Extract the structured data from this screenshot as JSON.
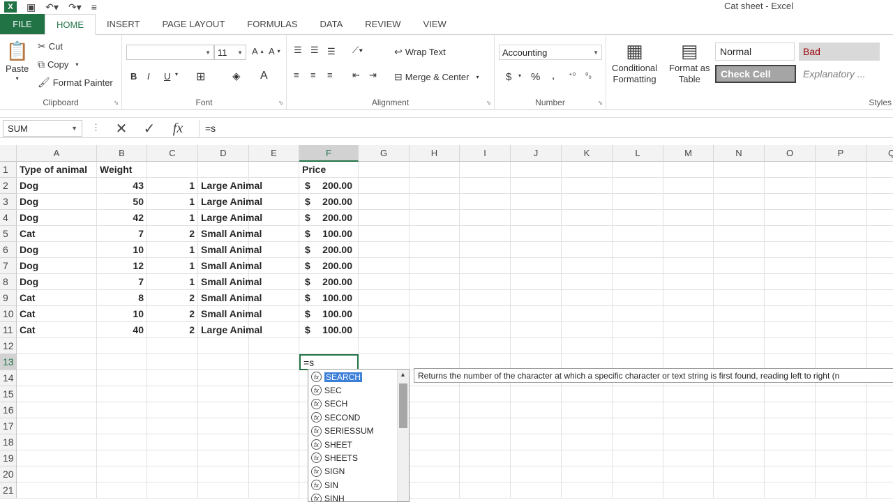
{
  "window": {
    "title": "Cat sheet - Excel",
    "app_icon": "X"
  },
  "tabs": [
    "FILE",
    "HOME",
    "INSERT",
    "PAGE LAYOUT",
    "FORMULAS",
    "DATA",
    "REVIEW",
    "VIEW"
  ],
  "clipboard": {
    "paste": "Paste",
    "cut": "Cut",
    "copy": "Copy",
    "format_painter": "Format Painter",
    "label": "Clipboard"
  },
  "font": {
    "name": "",
    "size": "11",
    "bold": "B",
    "italic": "I",
    "underline": "U",
    "label": "Font"
  },
  "alignment": {
    "wrap_text": "Wrap Text",
    "merge_center": "Merge & Center",
    "label": "Alignment"
  },
  "number": {
    "format": "Accounting",
    "currency": "$",
    "percent": "%",
    "comma": ",",
    "label": "Number"
  },
  "styles": {
    "conditional_formatting": [
      "Conditional",
      "Formatting"
    ],
    "format_as_table": [
      "Format as",
      "Table"
    ],
    "normal": "Normal",
    "bad": "Bad",
    "check_cell": "Check Cell",
    "explanatory": "Explanatory ...",
    "label": "Styles",
    "normal_color": "#f2f2f2",
    "bad_color": "#ffc7ce",
    "check_color": "#a5a5a5"
  },
  "formula_bar": {
    "name_box": "SUM",
    "cancel": "✕",
    "enter": "✓",
    "fx": "fx",
    "content": "=s"
  },
  "columns": [
    "A",
    "B",
    "C",
    "D",
    "E",
    "F",
    "G",
    "H",
    "I",
    "J",
    "K",
    "L",
    "M",
    "N",
    "O",
    "P",
    "Q"
  ],
  "rows": [
    "1",
    "2",
    "3",
    "4",
    "5",
    "6",
    "7",
    "8",
    "9",
    "10",
    "11",
    "12",
    "13",
    "14",
    "15",
    "16",
    "17",
    "18",
    "19",
    "20",
    "21"
  ],
  "sheet": {
    "headers": {
      "a": "Type of animal",
      "b": "Weight",
      "f": "Price"
    },
    "data": [
      [
        "Dog",
        "43",
        "1",
        "Large Animal",
        "$",
        "200.00"
      ],
      [
        "Dog",
        "50",
        "1",
        "Large Animal",
        "$",
        "200.00"
      ],
      [
        "Dog",
        "42",
        "1",
        "Large Animal",
        "$",
        "200.00"
      ],
      [
        "Cat",
        "7",
        "2",
        "Small Animal",
        "$",
        "100.00"
      ],
      [
        "Dog",
        "10",
        "1",
        "Small Animal",
        "$",
        "200.00"
      ],
      [
        "Dog",
        "12",
        "1",
        "Small Animal",
        "$",
        "200.00"
      ],
      [
        "Dog",
        "7",
        "1",
        "Small Animal",
        "$",
        "200.00"
      ],
      [
        "Cat",
        "8",
        "2",
        "Small Animal",
        "$",
        "100.00"
      ],
      [
        "Cat",
        "10",
        "2",
        "Small Animal",
        "$",
        "100.00"
      ],
      [
        "Cat",
        "40",
        "2",
        "Large Animal",
        "$",
        "100.00"
      ]
    ],
    "active_cell": "=s"
  },
  "autocomplete": {
    "items": [
      "SEARCH",
      "SEC",
      "SECH",
      "SECOND",
      "SERIESSUM",
      "SHEET",
      "SHEETS",
      "SIGN",
      "SIN",
      "SINH"
    ],
    "tooltip": "Returns the number of the character at which a specific character or text string is first found, reading left to right (n"
  }
}
